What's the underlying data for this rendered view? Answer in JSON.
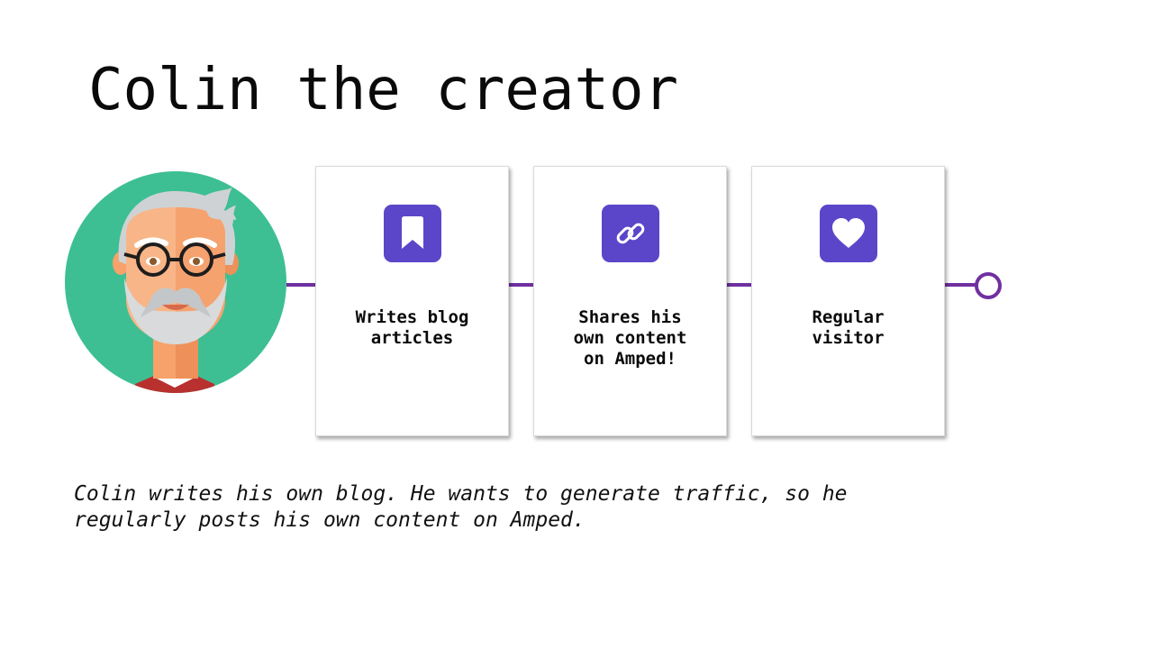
{
  "slide": {
    "title": "Colin the creator",
    "description": "Colin writes his own blog. He wants to generate traffic, so he regularly posts his own content on Amped."
  },
  "avatar": {
    "icon": "old-man-glasses-avatar",
    "background_color": "#3dbf93"
  },
  "timeline": {
    "line_color": "#7030a0",
    "cards": [
      {
        "icon": "bookmark-icon",
        "label": "Writes blog\narticles"
      },
      {
        "icon": "link-icon",
        "label": "Shares his\nown content\non Amped!"
      },
      {
        "icon": "heart-icon",
        "label": "Regular\nvisitor"
      }
    ]
  },
  "colors": {
    "icon_tile": "#5b46c9",
    "accent_line": "#7030a0"
  }
}
